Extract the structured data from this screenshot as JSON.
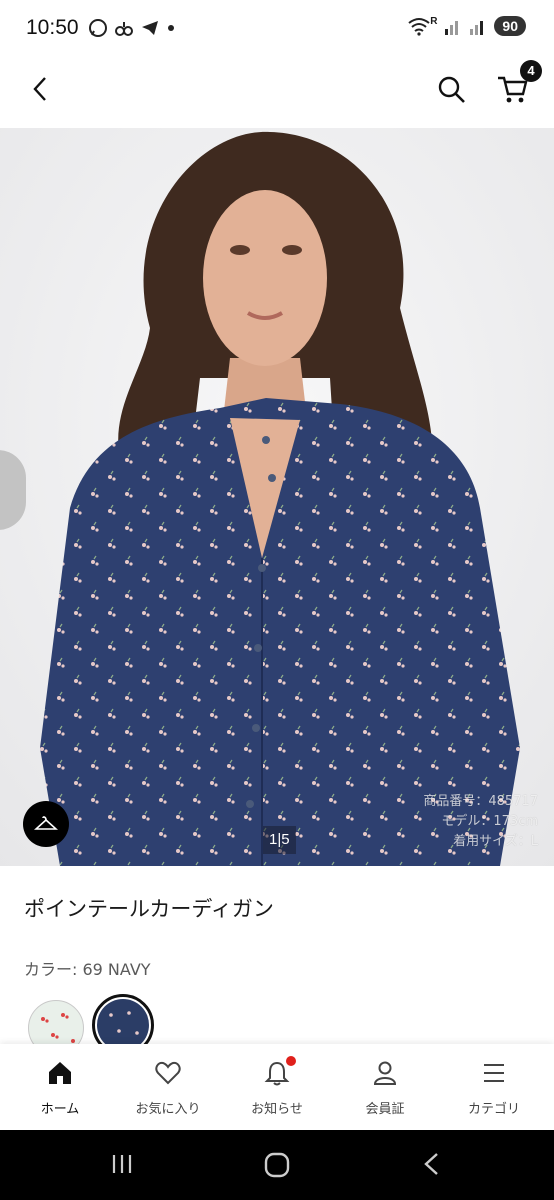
{
  "status_bar": {
    "time": "10:50",
    "left_icons": [
      "whatsapp-icon",
      "alarm-icon",
      "telegram-icon",
      "dot-icon"
    ],
    "right_icons": [
      "wifi-icon",
      "signal-icon"
    ],
    "roaming": "R",
    "battery": "90"
  },
  "header": {
    "cart_count": "4"
  },
  "hero": {
    "page_indicator": "1|5",
    "model_info": {
      "product_number": "商品番号：485717",
      "model_height": "モデル：173cm",
      "size_worn": "着用サイズ：L"
    }
  },
  "product": {
    "title": "ポインテールカーディガン",
    "color_label": "カラー: 69 NAVY",
    "swatches": [
      {
        "name": "white",
        "color": "#e9f0ea",
        "selected": false
      },
      {
        "name": "navy",
        "color": "#2b3d66",
        "selected": true
      }
    ]
  },
  "bottom_nav": {
    "items": [
      {
        "label": "ホーム",
        "icon": "home-icon",
        "active": true
      },
      {
        "label": "お気に入り",
        "icon": "heart-icon",
        "active": false
      },
      {
        "label": "お知らせ",
        "icon": "bell-icon",
        "active": false,
        "has_badge": true
      },
      {
        "label": "会員証",
        "icon": "person-icon",
        "active": false
      },
      {
        "label": "カテゴリ",
        "icon": "menu-icon",
        "active": false
      }
    ]
  },
  "colors": {
    "accent": "#111111",
    "badge_red": "#e0201b",
    "navy": "#2b3d66"
  }
}
